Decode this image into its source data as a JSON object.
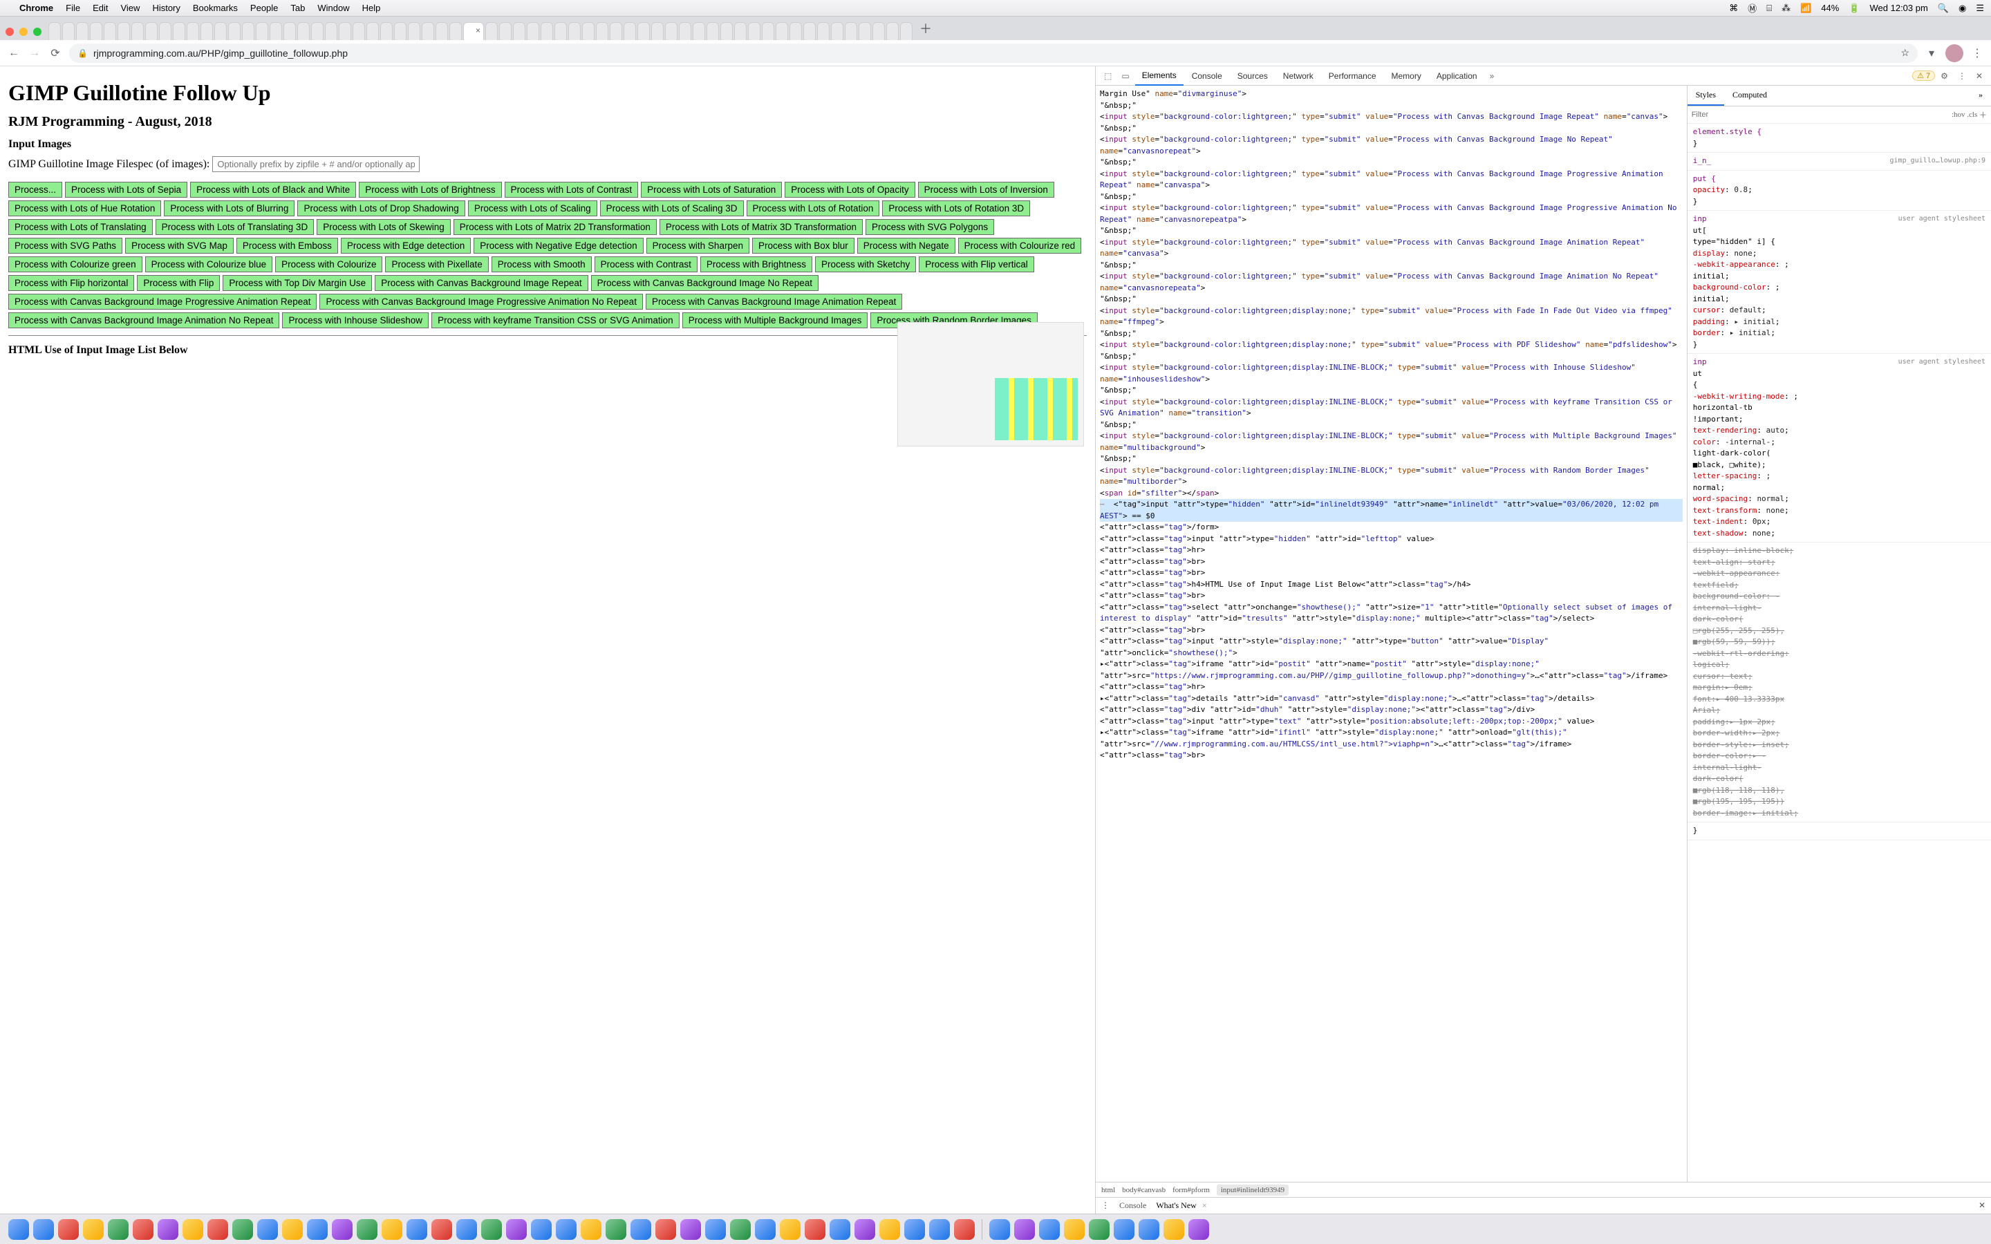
{
  "menubar": {
    "app": "Chrome",
    "items": [
      "File",
      "Edit",
      "View",
      "History",
      "Bookmarks",
      "People",
      "Tab",
      "Window",
      "Help"
    ],
    "battery": "44%",
    "clock": "Wed 12:03 pm"
  },
  "omnibox": {
    "url": "rjmprogramming.com.au/PHP/gimp_guillotine_followup.php"
  },
  "page": {
    "h1": "GIMP Guillotine Follow Up",
    "h2": "RJM Programming - August, 2018",
    "h3a": "Input Images",
    "filespec_label": "GIMP Guillotine Image Filespec (of images): ",
    "filespec_placeholder": "Optionally prefix by zipfile + # and/or optionally apper",
    "buttons": [
      "Process...",
      "Process with Lots of Sepia",
      "Process with Lots of Black and White",
      "Process with Lots of Brightness",
      "Process with Lots of Contrast",
      "Process with Lots of Saturation",
      "Process with Lots of Opacity",
      "Process with Lots of Inversion",
      "Process with Lots of Hue Rotation",
      "Process with Lots of Blurring",
      "Process with Lots of Drop Shadowing",
      "Process with Lots of Scaling",
      "Process with Lots of Scaling 3D",
      "Process with Lots of Rotation",
      "Process with Lots of Rotation 3D",
      "Process with Lots of Translating",
      "Process with Lots of Translating 3D",
      "Process with Lots of Skewing",
      "Process with Lots of Matrix 2D Transformation",
      "Process with Lots of Matrix 3D Transformation",
      "Process with SVG Polygons",
      "Process with SVG Paths",
      "Process with SVG Map",
      "Process with Emboss",
      "Process with Edge detection",
      "Process with Negative Edge detection",
      "Process with Sharpen",
      "Process with Box blur",
      "Process with Negate",
      "Process with Colourize red",
      "Process with Colourize green",
      "Process with Colourize blue",
      "Process with Colourize",
      "Process with Pixellate",
      "Process with Smooth",
      "Process with Contrast",
      "Process with Brightness",
      "Process with Sketchy",
      "Process with Flip vertical",
      "Process with Flip horizontal",
      "Process with Flip",
      "Process with Top Div Margin Use",
      "Process with Canvas Background Image Repeat",
      "Process with Canvas Background Image No Repeat",
      "Process with Canvas Background Image Progressive Animation Repeat",
      "Process with Canvas Background Image Progressive Animation No Repeat",
      "Process with Canvas Background Image Animation Repeat",
      "Process with Canvas Background Image Animation No Repeat",
      "Process with Inhouse Slideshow",
      "Process with keyframe Transition CSS or SVG Animation",
      "Process with Multiple Background Images",
      "Process with Random Border Images"
    ],
    "h3b": "HTML Use of Input Image List Below"
  },
  "devtools": {
    "tabs": [
      "Elements",
      "Console",
      "Sources",
      "Network",
      "Performance",
      "Memory",
      "Application"
    ],
    "warn_count": "7",
    "styles_tabs": [
      "Styles",
      "Computed"
    ],
    "filter_placeholder": "Filter",
    "hov": ":hov",
    "cls": ".cls",
    "crumbs": [
      "html",
      "body#canvasb",
      "form#pform",
      "input#inlineldt93949"
    ],
    "drawer": [
      "Console",
      "What's New"
    ],
    "selected_line": "<input type=\"hidden\" id=\"inlineldt93949\" name=\"inlineldt\" value=\"03/06/2020, 12:02 pm AEST\"> == $0",
    "dom_lines": [
      {
        "pre": "",
        "html": "Margin Use\" <span class='attr'>name</span>=<span class='val'>\"divmarginuse\"</span>&gt;"
      },
      {
        "pre": "",
        "html": "<span class='txt'>\"&amp;nbsp;\"</span>"
      },
      {
        "pre": "",
        "html": "&lt;<span class='tag'>input</span> <span class='attr'>style</span>=<span class='val'>\"background-color:lightgreen;\"</span> <span class='attr'>type</span>=<span class='val'>\"submit\"</span> <span class='attr'>value</span>=<span class='val'>\"Process with Canvas Background Image Repeat\"</span> <span class='attr'>name</span>=<span class='val'>\"canvas\"</span>&gt;"
      },
      {
        "pre": "",
        "html": "<span class='txt'>\"&amp;nbsp;\"</span>"
      },
      {
        "pre": "",
        "html": "&lt;<span class='tag'>input</span> <span class='attr'>style</span>=<span class='val'>\"background-color:lightgreen;\"</span> <span class='attr'>type</span>=<span class='val'>\"submit\"</span> <span class='attr'>value</span>=<span class='val'>\"Process with Canvas Background Image No Repeat\"</span> <span class='attr'>name</span>=<span class='val'>\"canvasnorepeat\"</span>&gt;"
      },
      {
        "pre": "",
        "html": "<span class='txt'>\"&amp;nbsp;\"</span>"
      },
      {
        "pre": "",
        "html": "&lt;<span class='tag'>input</span> <span class='attr'>style</span>=<span class='val'>\"background-color:lightgreen;\"</span> <span class='attr'>type</span>=<span class='val'>\"submit\"</span> <span class='attr'>value</span>=<span class='val'>\"Process with Canvas Background Image Progressive Animation Repeat\"</span> <span class='attr'>name</span>=<span class='val'>\"canvaspa\"</span>&gt;"
      },
      {
        "pre": "",
        "html": "<span class='txt'>\"&amp;nbsp;\"</span>"
      },
      {
        "pre": "",
        "html": "&lt;<span class='tag'>input</span> <span class='attr'>style</span>=<span class='val'>\"background-color:lightgreen;\"</span> <span class='attr'>type</span>=<span class='val'>\"submit\"</span> <span class='attr'>value</span>=<span class='val'>\"Process with Canvas Background Image Progressive Animation No Repeat\"</span> <span class='attr'>name</span>=<span class='val'>\"canvasnorepeatpa\"</span>&gt;"
      },
      {
        "pre": "",
        "html": "<span class='txt'>\"&amp;nbsp;\"</span>"
      },
      {
        "pre": "",
        "html": "&lt;<span class='tag'>input</span> <span class='attr'>style</span>=<span class='val'>\"background-color:lightgreen;\"</span> <span class='attr'>type</span>=<span class='val'>\"submit\"</span> <span class='attr'>value</span>=<span class='val'>\"Process with Canvas Background Image Animation Repeat\"</span> <span class='attr'>name</span>=<span class='val'>\"canvasa\"</span>&gt;"
      },
      {
        "pre": "",
        "html": "<span class='txt'>\"&amp;nbsp;\"</span>"
      },
      {
        "pre": "",
        "html": "&lt;<span class='tag'>input</span> <span class='attr'>style</span>=<span class='val'>\"background-color:lightgreen;\"</span> <span class='attr'>type</span>=<span class='val'>\"submit\"</span> <span class='attr'>value</span>=<span class='val'>\"Process with Canvas Background Image Animation No Repeat\"</span> <span class='attr'>name</span>=<span class='val'>\"canvasnorepeata\"</span>&gt;"
      },
      {
        "pre": "",
        "html": "<span class='txt'>\"&amp;nbsp;\"</span>"
      },
      {
        "pre": "",
        "html": "&lt;<span class='tag'>input</span> <span class='attr'>style</span>=<span class='val'>\"background-color:lightgreen;display:none;\"</span> <span class='attr'>type</span>=<span class='val'>\"submit\"</span> <span class='attr'>value</span>=<span class='val'>\"Process with Fade In Fade Out Video via ffmpeg\"</span> <span class='attr'>name</span>=<span class='val'>\"ffmpeg\"</span>&gt;"
      },
      {
        "pre": "",
        "html": "<span class='txt'>\"&amp;nbsp;\"</span>"
      },
      {
        "pre": "",
        "html": "&lt;<span class='tag'>input</span> <span class='attr'>style</span>=<span class='val'>\"background-color:lightgreen;display:none;\"</span> <span class='attr'>type</span>=<span class='val'>\"submit\"</span> <span class='attr'>value</span>=<span class='val'>\"Process with PDF Slideshow\"</span> <span class='attr'>name</span>=<span class='val'>\"pdfslideshow\"</span>&gt;"
      },
      {
        "pre": "",
        "html": "<span class='txt'>\"&amp;nbsp;\"</span>"
      },
      {
        "pre": "",
        "html": "&lt;<span class='tag'>input</span> <span class='attr'>style</span>=<span class='val'>\"background-color:lightgreen;display:INLINE-BLOCK;\"</span> <span class='attr'>type</span>=<span class='val'>\"submit\"</span> <span class='attr'>value</span>=<span class='val'>\"Process with Inhouse Slideshow\"</span> <span class='attr'>name</span>=<span class='val'>\"inhouseslideshow\"</span>&gt;"
      },
      {
        "pre": "",
        "html": "<span class='txt'>\"&amp;nbsp;\"</span>"
      },
      {
        "pre": "",
        "html": "&lt;<span class='tag'>input</span> <span class='attr'>style</span>=<span class='val'>\"background-color:lightgreen;display:INLINE-BLOCK;\"</span> <span class='attr'>type</span>=<span class='val'>\"submit\"</span> <span class='attr'>value</span>=<span class='val'>\"Process with keyframe Transition CSS or SVG Animation\"</span> <span class='attr'>name</span>=<span class='val'>\"transition\"</span>&gt;"
      },
      {
        "pre": "",
        "html": "<span class='txt'>\"&amp;nbsp;\"</span>"
      },
      {
        "pre": "",
        "html": "&lt;<span class='tag'>input</span> <span class='attr'>style</span>=<span class='val'>\"background-color:lightgreen;display:INLINE-BLOCK;\"</span> <span class='attr'>type</span>=<span class='val'>\"submit\"</span> <span class='attr'>value</span>=<span class='val'>\"Process with Multiple Background Images\"</span> <span class='attr'>name</span>=<span class='val'>\"multibackground\"</span>&gt;"
      },
      {
        "pre": "",
        "html": "<span class='txt'>\"&amp;nbsp;\"</span>"
      },
      {
        "pre": "",
        "html": "&lt;<span class='tag'>input</span> <span class='attr'>style</span>=<span class='val'>\"background-color:lightgreen;display:INLINE-BLOCK;\"</span> <span class='attr'>type</span>=<span class='val'>\"submit\"</span> <span class='attr'>value</span>=<span class='val'>\"Process with Random Border Images\"</span> <span class='attr'>name</span>=<span class='val'>\"multiborder\"</span>&gt;"
      },
      {
        "pre": "",
        "html": "&lt;<span class='tag'>span</span> <span class='attr'>id</span>=<span class='val'>\"sfilter\"</span>&gt;&lt;/<span class='tag'>span</span>&gt;"
      }
    ],
    "dom_after": [
      "</form>",
      "<input type=\"hidden\" id=\"lefttop\" value>",
      "<hr>",
      "<br>",
      "<br>",
      "<h4>HTML Use of Input Image List Below</h4>",
      "<br>",
      "<select onchange=\"showthese();\" size=\"1\" title=\"Optionally select subset of images of interest to display\" id=\"tresults\" style=\"display:none;\" multiple></select>",
      "<br>",
      "<input style=\"display:none;\" type=\"button\" value=\"Display\" onclick=\"showthese();\">",
      "▸<iframe id=\"postit\" name=\"postit\" style=\"display:none;\" src=\"https://www.rjmprogramming.com.au/PHP//gimp_guillotine_followup.php?donothing=y\">…</iframe>",
      "<hr>",
      "▸<details id=\"canvasd\" style=\"display:none;\">…</details>",
      "<div id=\"dhuh\" style=\"display:none;\"></div>",
      "<input type=\"text\" style=\"position:absolute;left:-200px;top:-200px;\" value>",
      "▸<iframe id=\"ifintl\" style=\"display:none;\" onload=\"glt(this);\" src=\"//www.rjmprogramming.com.au/HTMLCSS/intl_use.html?viaphp=n\">…</iframe>",
      "<br>"
    ],
    "rules": [
      {
        "selector": "element.style {",
        "src": "",
        "body": [
          "}"
        ]
      },
      {
        "selector": "i̲n̲",
        "src": "gimp_guillo…lowup.php:9",
        "body": []
      },
      {
        "selector": "put {",
        "src": "",
        "body": [
          "  opacity: 0.8;",
          "}"
        ]
      },
      {
        "selector": "inp",
        "src": "user agent stylesheet",
        "body": [
          "ut[",
          "type=\"hidden\" i] {",
          "  display: none;",
          "  -webkit-appearance:",
          "               initial;",
          "  background-color:",
          "               initial;",
          "  cursor: default;",
          "  padding:▸ initial;",
          "  border:▸ initial;",
          "}"
        ]
      },
      {
        "selector": "inp",
        "src": "user agent stylesheet",
        "body": [
          "ut",
          "{",
          "  -webkit-writing-mode:",
          "        horizontal-tb",
          "            !important;",
          "  text-rendering: auto;",
          "  color: -internal-",
          "      light-dark-color(",
          "      ■black, □white);",
          "  letter-spacing:",
          "             normal;",
          "  word-spacing: normal;",
          "  text-transform: none;",
          "  text-indent: 0px;",
          "  text-shadow: none;"
        ]
      }
    ],
    "strikes": [
      "display: inline-block;",
      "text-align: start;",
      "-webkit-appearance:",
      "         textfield;",
      "background-color: -",
      "    internal-light-",
      "dark-color(",
      "□rgb(255, 255, 255),",
      "■rgb(59, 59, 59));",
      "-webkit-rtl-ordering:",
      "            logical;",
      "cursor: text;",
      "margin:▸ 0em;",
      "font:▸ 400 13.3333px",
      "             Arial;",
      "padding:▸ 1px 2px;",
      "border-width:▸ 2px;",
      "border-style:▸ inset;",
      "border-color:▸ -",
      "    internal-light-",
      "dark-color(",
      "■rgb(118, 118, 118),",
      "■rgb(195, 195, 195))",
      "border-image:▸ initial;"
    ]
  }
}
